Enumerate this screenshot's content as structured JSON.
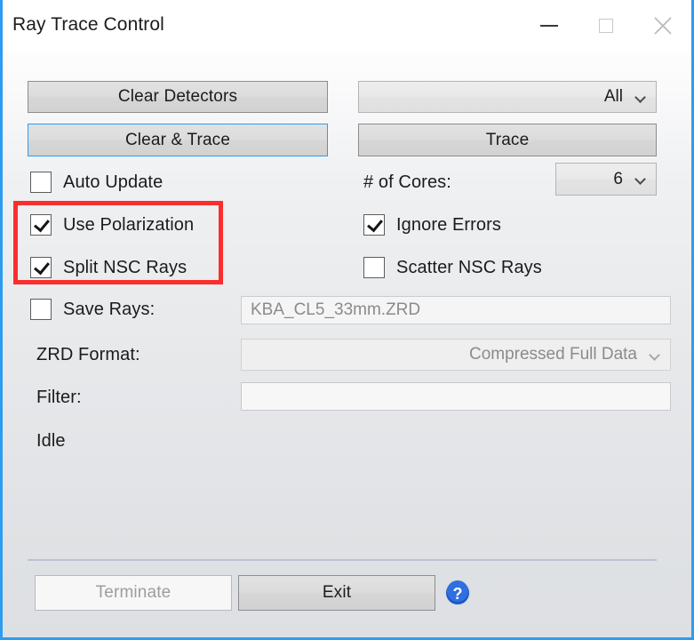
{
  "window": {
    "title": "Ray Trace Control",
    "accent_border": "#2d9cf0",
    "caption": {
      "minimize_name": "minimize-icon",
      "maximize_name": "maximize-icon",
      "close_name": "close-icon"
    }
  },
  "actions": {
    "clear_detectors": "Clear Detectors",
    "clear_and_trace": "Clear & Trace",
    "trace": "Trace"
  },
  "selectors": {
    "scope": {
      "value": "All"
    },
    "cores": {
      "label": "# of Cores:",
      "value": "6"
    },
    "zrd_format": {
      "label": "ZRD Format:",
      "value": "Compressed Full Data"
    }
  },
  "checkboxes": [
    {
      "label": "Auto Update",
      "checked": false
    },
    {
      "label": "Use Polarization",
      "checked": true
    },
    {
      "label": "Split NSC Rays",
      "checked": true
    },
    {
      "label": "Ignore Errors",
      "checked": true
    },
    {
      "label": "Scatter NSC Rays",
      "checked": false
    },
    {
      "label": "Save Rays:",
      "checked": false
    }
  ],
  "fields": {
    "save_rays_file": {
      "value": "KBA_CL5_33mm.ZRD"
    },
    "filter": {
      "label": "Filter:",
      "value": ""
    }
  },
  "status": {
    "text": "Idle"
  },
  "footer": {
    "terminate": "Terminate",
    "exit": "Exit",
    "help_icon": "help-icon"
  },
  "annotation": {
    "color": "#fb2e2e",
    "highlights": [
      "Use Polarization",
      "Split NSC Rays"
    ]
  }
}
